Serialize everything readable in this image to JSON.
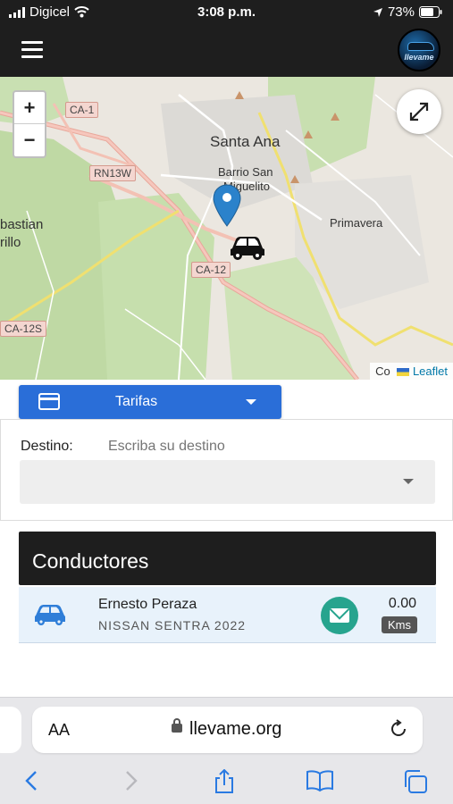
{
  "status_bar": {
    "carrier": "Digicel",
    "time": "3:08 p.m.",
    "battery": "73%"
  },
  "header": {
    "logo_text": "llevame"
  },
  "map": {
    "labels": {
      "santa_ana": "Santa Ana",
      "barrio_line1": "Barrio San",
      "barrio_line2": "Miguelito",
      "primavera": "Primavera",
      "bastian": "bastian",
      "rillo": "rillo"
    },
    "shields": {
      "ca1": "CA-1",
      "rn13w": "RN13W",
      "ca12": "CA-12",
      "ca12s": "CA-12S"
    },
    "zoom_in": "+",
    "zoom_out": "−",
    "attribution_prefix": "Co",
    "attribution_link": "Leaflet"
  },
  "tarifas": {
    "label": "Tarifas"
  },
  "destino": {
    "label": "Destino:",
    "placeholder": "Escriba su destino"
  },
  "conductores": {
    "title": "Conductores",
    "drivers": [
      {
        "name": "Ernesto Peraza",
        "car": "NISSAN SENTRA 2022",
        "distance": "0.00",
        "unit": "Kms"
      }
    ]
  },
  "browser": {
    "aa": "AA",
    "url": "llevame.org"
  }
}
